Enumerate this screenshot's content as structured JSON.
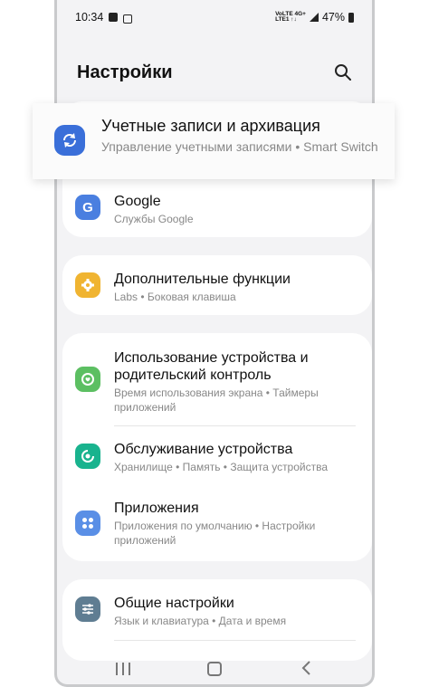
{
  "status_bar": {
    "time": "10:34",
    "network_line1": "VoLTE 4G+",
    "network_line2": "LTE1 ↑↓",
    "battery": "47%"
  },
  "header": {
    "title": "Настройки",
    "search_icon": "search-icon"
  },
  "highlighted_item": {
    "title": "Учетные записи и архивация",
    "subtitle": "Управление учетными записями  •  Smart Switch",
    "icon": "sync-icon",
    "icon_color": "#3a6fd9"
  },
  "groups": [
    {
      "items": [
        {
          "title": "Google",
          "subtitle": "Службы Google",
          "icon": "google-icon",
          "icon_color": "#4a7fe0"
        }
      ]
    },
    {
      "items": [
        {
          "title": "Дополнительные функции",
          "subtitle": "Labs  •  Боковая клавиша",
          "icon": "plus-gear-icon",
          "icon_color": "#f0b431"
        }
      ]
    },
    {
      "items": [
        {
          "title": "Использование устройства и родительский контроль",
          "subtitle": "Время использования экрана  •  Таймеры приложений",
          "icon": "digital-wellbeing-icon",
          "icon_color": "#5cbf62"
        },
        {
          "title": "Обслуживание устройства",
          "subtitle": "Хранилище  •  Память  •  Защита устройства",
          "icon": "device-care-icon",
          "icon_color": "#19b38e"
        },
        {
          "title": "Приложения",
          "subtitle": "Приложения по умолчанию  •  Настройки приложений",
          "icon": "apps-icon",
          "icon_color": "#5a8fe6"
        }
      ]
    },
    {
      "items": [
        {
          "title": "Общие настройки",
          "subtitle": "Язык и клавиатура  •  Дата и время",
          "icon": "sliders-icon",
          "icon_color": "#5f7d92"
        }
      ]
    }
  ],
  "nav_bar": {
    "recents": "recents-icon",
    "home": "home-icon",
    "back": "back-icon"
  }
}
